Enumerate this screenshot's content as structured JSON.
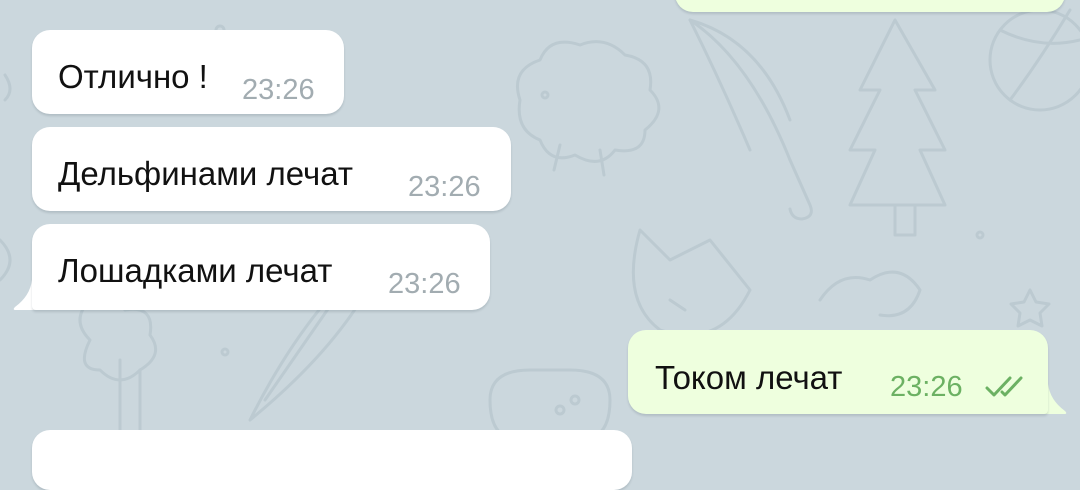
{
  "messages": [
    {
      "id": "m1",
      "direction": "incoming",
      "text": "Отлично !",
      "time": "23:26"
    },
    {
      "id": "m2",
      "direction": "incoming",
      "text": "Дельфинами лечат",
      "time": "23:26"
    },
    {
      "id": "m3",
      "direction": "incoming",
      "text": "Лошадками лечат",
      "time": "23:26"
    },
    {
      "id": "m4",
      "direction": "outgoing",
      "text": "Током лечат",
      "time": "23:26",
      "status": "read"
    }
  ],
  "colors": {
    "background": "#cbd7dd",
    "incoming_bubble": "#ffffff",
    "outgoing_bubble": "#eeffde",
    "outgoing_time": "#6cb163",
    "incoming_time": "#a2acb1",
    "read_checks": "#6cb163"
  },
  "icons": {
    "read_status": "double-check-icon"
  }
}
